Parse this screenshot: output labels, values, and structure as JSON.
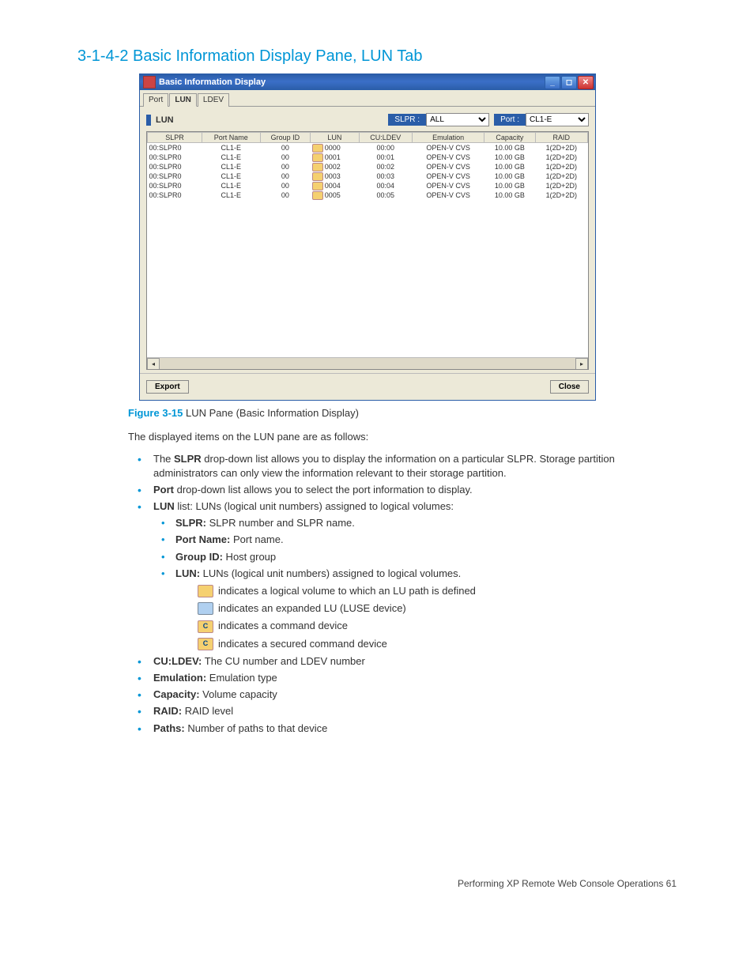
{
  "heading": "3-1-4-2 Basic Information Display Pane, LUN Tab",
  "window": {
    "title": "Basic Information Display",
    "tabs": [
      "Port",
      "LUN",
      "LDEV"
    ],
    "activeTab": "LUN",
    "paneLabel": "LUN",
    "slprLabel": "SLPR :",
    "slprValue": "ALL",
    "portLabel": "Port :",
    "portValue": "CL1-E",
    "columns": [
      "SLPR",
      "Port Name",
      "Group ID",
      "LUN",
      "CU:LDEV",
      "Emulation",
      "Capacity",
      "RAID"
    ],
    "rows": [
      {
        "slpr": "00:SLPR0",
        "port": "CL1-E",
        "gid": "00",
        "lun": "0000",
        "culdev": "00:00",
        "emu": "OPEN-V CVS",
        "cap": "10.00 GB",
        "raid": "1(2D+2D)"
      },
      {
        "slpr": "00:SLPR0",
        "port": "CL1-E",
        "gid": "00",
        "lun": "0001",
        "culdev": "00:01",
        "emu": "OPEN-V CVS",
        "cap": "10.00 GB",
        "raid": "1(2D+2D)"
      },
      {
        "slpr": "00:SLPR0",
        "port": "CL1-E",
        "gid": "00",
        "lun": "0002",
        "culdev": "00:02",
        "emu": "OPEN-V CVS",
        "cap": "10.00 GB",
        "raid": "1(2D+2D)"
      },
      {
        "slpr": "00:SLPR0",
        "port": "CL1-E",
        "gid": "00",
        "lun": "0003",
        "culdev": "00:03",
        "emu": "OPEN-V CVS",
        "cap": "10.00 GB",
        "raid": "1(2D+2D)"
      },
      {
        "slpr": "00:SLPR0",
        "port": "CL1-E",
        "gid": "00",
        "lun": "0004",
        "culdev": "00:04",
        "emu": "OPEN-V CVS",
        "cap": "10.00 GB",
        "raid": "1(2D+2D)"
      },
      {
        "slpr": "00:SLPR0",
        "port": "CL1-E",
        "gid": "00",
        "lun": "0005",
        "culdev": "00:05",
        "emu": "OPEN-V CVS",
        "cap": "10.00 GB",
        "raid": "1(2D+2D)"
      }
    ],
    "exportBtn": "Export",
    "closeBtn": "Close"
  },
  "figure": {
    "number": "Figure 3-15",
    "caption": "LUN Pane (Basic Information Display)"
  },
  "intro": "The displayed items on the LUN pane are as follows:",
  "bullets": {
    "slpr_b": "SLPR",
    "slpr_t": " drop-down list allows you to display the information on a particular SLPR. Storage partition administrators can only view the information relevant to their storage partition.",
    "port_b": "Port",
    "port_t": " drop-down list allows you to select the port information to display.",
    "lun_b": "LUN",
    "lun_t": " list: LUNs (logical unit numbers) assigned to logical volumes:",
    "sub": {
      "slpr_b": "SLPR:",
      "slpr_t": " SLPR number and SLPR name.",
      "pn_b": "Port Name:",
      "pn_t": " Port name.",
      "gid_b": "Group ID:",
      "gid_t": " Host group",
      "lun_b": "LUN:",
      "lun_t": " LUNs (logical unit numbers) assigned to logical volumes.",
      "icon1": "indicates a logical volume to which an LU path is defined",
      "icon2": "indicates an expanded LU (LUSE device)",
      "icon3": "indicates a command device",
      "icon4": "indicates a secured command device"
    },
    "culdev_b": "CU:LDEV:",
    "culdev_t": "  The CU number and LDEV number",
    "emu_b": "Emulation:",
    "emu_t": "  Emulation type",
    "cap_b": "Capacity:",
    "cap_t": "  Volume capacity",
    "raid_b": "RAID:",
    "raid_t": "  RAID level",
    "paths_b": "Paths:",
    "paths_t": "  Number of paths to that device"
  },
  "footer": "Performing XP Remote Web Console Operations   61"
}
